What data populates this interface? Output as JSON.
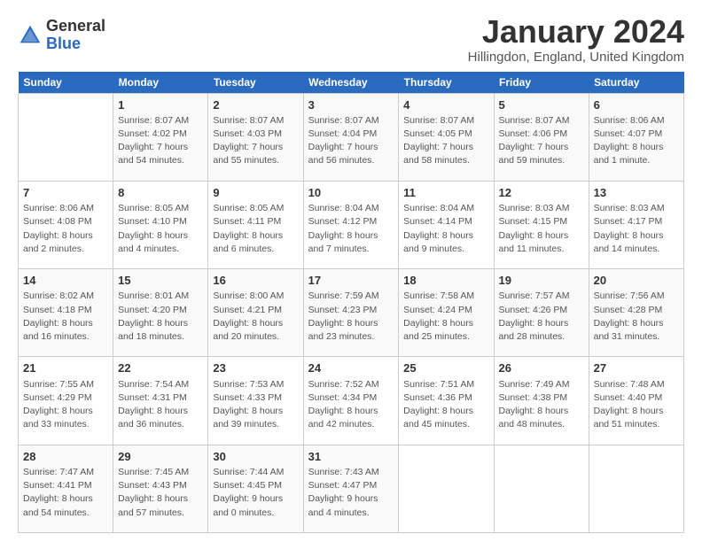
{
  "header": {
    "logo_general": "General",
    "logo_blue": "Blue",
    "title": "January 2024",
    "subtitle": "Hillingdon, England, United Kingdom"
  },
  "weekdays": [
    "Sunday",
    "Monday",
    "Tuesday",
    "Wednesday",
    "Thursday",
    "Friday",
    "Saturday"
  ],
  "weeks": [
    [
      {
        "day": "",
        "details": ""
      },
      {
        "day": "1",
        "details": "Sunrise: 8:07 AM\nSunset: 4:02 PM\nDaylight: 7 hours\nand 54 minutes."
      },
      {
        "day": "2",
        "details": "Sunrise: 8:07 AM\nSunset: 4:03 PM\nDaylight: 7 hours\nand 55 minutes."
      },
      {
        "day": "3",
        "details": "Sunrise: 8:07 AM\nSunset: 4:04 PM\nDaylight: 7 hours\nand 56 minutes."
      },
      {
        "day": "4",
        "details": "Sunrise: 8:07 AM\nSunset: 4:05 PM\nDaylight: 7 hours\nand 58 minutes."
      },
      {
        "day": "5",
        "details": "Sunrise: 8:07 AM\nSunset: 4:06 PM\nDaylight: 7 hours\nand 59 minutes."
      },
      {
        "day": "6",
        "details": "Sunrise: 8:06 AM\nSunset: 4:07 PM\nDaylight: 8 hours\nand 1 minute."
      }
    ],
    [
      {
        "day": "7",
        "details": "Sunrise: 8:06 AM\nSunset: 4:08 PM\nDaylight: 8 hours\nand 2 minutes."
      },
      {
        "day": "8",
        "details": "Sunrise: 8:05 AM\nSunset: 4:10 PM\nDaylight: 8 hours\nand 4 minutes."
      },
      {
        "day": "9",
        "details": "Sunrise: 8:05 AM\nSunset: 4:11 PM\nDaylight: 8 hours\nand 6 minutes."
      },
      {
        "day": "10",
        "details": "Sunrise: 8:04 AM\nSunset: 4:12 PM\nDaylight: 8 hours\nand 7 minutes."
      },
      {
        "day": "11",
        "details": "Sunrise: 8:04 AM\nSunset: 4:14 PM\nDaylight: 8 hours\nand 9 minutes."
      },
      {
        "day": "12",
        "details": "Sunrise: 8:03 AM\nSunset: 4:15 PM\nDaylight: 8 hours\nand 11 minutes."
      },
      {
        "day": "13",
        "details": "Sunrise: 8:03 AM\nSunset: 4:17 PM\nDaylight: 8 hours\nand 14 minutes."
      }
    ],
    [
      {
        "day": "14",
        "details": "Sunrise: 8:02 AM\nSunset: 4:18 PM\nDaylight: 8 hours\nand 16 minutes."
      },
      {
        "day": "15",
        "details": "Sunrise: 8:01 AM\nSunset: 4:20 PM\nDaylight: 8 hours\nand 18 minutes."
      },
      {
        "day": "16",
        "details": "Sunrise: 8:00 AM\nSunset: 4:21 PM\nDaylight: 8 hours\nand 20 minutes."
      },
      {
        "day": "17",
        "details": "Sunrise: 7:59 AM\nSunset: 4:23 PM\nDaylight: 8 hours\nand 23 minutes."
      },
      {
        "day": "18",
        "details": "Sunrise: 7:58 AM\nSunset: 4:24 PM\nDaylight: 8 hours\nand 25 minutes."
      },
      {
        "day": "19",
        "details": "Sunrise: 7:57 AM\nSunset: 4:26 PM\nDaylight: 8 hours\nand 28 minutes."
      },
      {
        "day": "20",
        "details": "Sunrise: 7:56 AM\nSunset: 4:28 PM\nDaylight: 8 hours\nand 31 minutes."
      }
    ],
    [
      {
        "day": "21",
        "details": "Sunrise: 7:55 AM\nSunset: 4:29 PM\nDaylight: 8 hours\nand 33 minutes."
      },
      {
        "day": "22",
        "details": "Sunrise: 7:54 AM\nSunset: 4:31 PM\nDaylight: 8 hours\nand 36 minutes."
      },
      {
        "day": "23",
        "details": "Sunrise: 7:53 AM\nSunset: 4:33 PM\nDaylight: 8 hours\nand 39 minutes."
      },
      {
        "day": "24",
        "details": "Sunrise: 7:52 AM\nSunset: 4:34 PM\nDaylight: 8 hours\nand 42 minutes."
      },
      {
        "day": "25",
        "details": "Sunrise: 7:51 AM\nSunset: 4:36 PM\nDaylight: 8 hours\nand 45 minutes."
      },
      {
        "day": "26",
        "details": "Sunrise: 7:49 AM\nSunset: 4:38 PM\nDaylight: 8 hours\nand 48 minutes."
      },
      {
        "day": "27",
        "details": "Sunrise: 7:48 AM\nSunset: 4:40 PM\nDaylight: 8 hours\nand 51 minutes."
      }
    ],
    [
      {
        "day": "28",
        "details": "Sunrise: 7:47 AM\nSunset: 4:41 PM\nDaylight: 8 hours\nand 54 minutes."
      },
      {
        "day": "29",
        "details": "Sunrise: 7:45 AM\nSunset: 4:43 PM\nDaylight: 8 hours\nand 57 minutes."
      },
      {
        "day": "30",
        "details": "Sunrise: 7:44 AM\nSunset: 4:45 PM\nDaylight: 9 hours\nand 0 minutes."
      },
      {
        "day": "31",
        "details": "Sunrise: 7:43 AM\nSunset: 4:47 PM\nDaylight: 9 hours\nand 4 minutes."
      },
      {
        "day": "",
        "details": ""
      },
      {
        "day": "",
        "details": ""
      },
      {
        "day": "",
        "details": ""
      }
    ]
  ]
}
